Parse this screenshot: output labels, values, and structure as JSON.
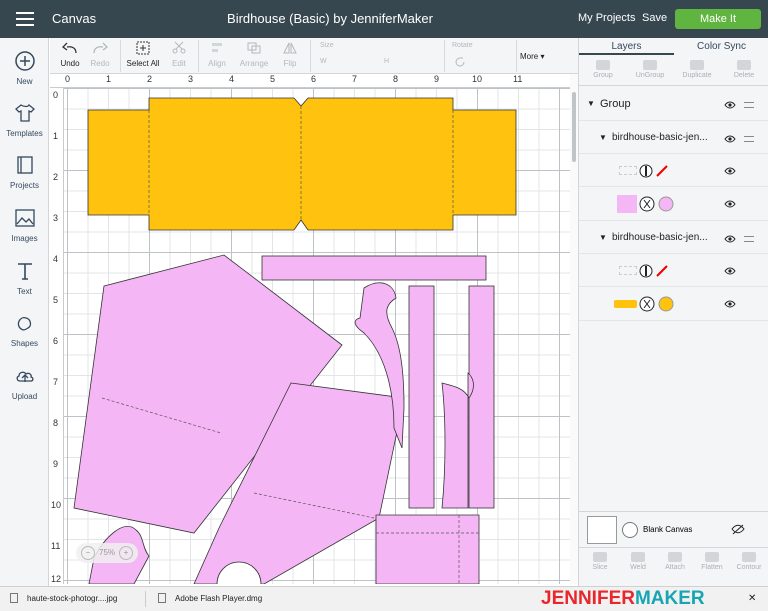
{
  "header": {
    "app_title": "Canvas",
    "project_title": "Birdhouse (Basic) by JenniferMaker",
    "my_projects": "My Projects",
    "save": "Save",
    "make_it": "Make It",
    "make_it_color": "#5fb53f",
    "bar_color": "#37474f"
  },
  "left_tools": [
    {
      "label": "New",
      "icon": "plus-circle-icon"
    },
    {
      "label": "Templates",
      "icon": "tshirt-icon"
    },
    {
      "label": "Projects",
      "icon": "book-icon"
    },
    {
      "label": "Images",
      "icon": "image-icon"
    },
    {
      "label": "Text",
      "icon": "text-t-icon"
    },
    {
      "label": "Shapes",
      "icon": "shapes-icon"
    },
    {
      "label": "Upload",
      "icon": "cloud-upload-icon"
    }
  ],
  "edit_toolbar": {
    "undo": "Undo",
    "redo": "Redo",
    "select_all": "Select All",
    "edit": "Edit",
    "align": "Align",
    "arrange": "Arrange",
    "flip": "Flip",
    "size": "Size",
    "w": "W",
    "h": "H",
    "rotate": "Rotate",
    "more": "More"
  },
  "ruler": {
    "top": [
      "0",
      "1",
      "2",
      "3",
      "4",
      "5",
      "6",
      "7",
      "8",
      "9",
      "10",
      "11"
    ],
    "left": [
      "0",
      "1",
      "2",
      "3",
      "4",
      "5",
      "6",
      "7",
      "8",
      "9",
      "10",
      "11",
      "12"
    ]
  },
  "canvas": {
    "zoom": "75%",
    "zoom_out": "−",
    "zoom_in": "+",
    "piece_colors": {
      "roof": "#ffc20e",
      "walls": "#f5b6f5"
    }
  },
  "right_panel": {
    "tabs": [
      "Layers",
      "Color Sync"
    ],
    "tools": [
      "Group",
      "UnGroup",
      "Duplicate",
      "Delete"
    ],
    "layers": [
      {
        "label": "Group",
        "level": 0
      },
      {
        "label": "birdhouse-basic-jen...",
        "level": 1
      },
      {
        "label": "",
        "level": 2,
        "swatch": "score"
      },
      {
        "label": "",
        "level": 2,
        "swatch": "pink"
      },
      {
        "label": "birdhouse-basic-jen...",
        "level": 1
      },
      {
        "label": "",
        "level": 2,
        "swatch": "score"
      },
      {
        "label": "",
        "level": 2,
        "swatch": "yellow"
      }
    ],
    "blank_canvas": "Blank Canvas",
    "bottom_tools": [
      "Slice",
      "Weld",
      "Attach",
      "Flatten",
      "Contour"
    ]
  },
  "downloads": {
    "file1": "haute-stock-photogr....jpg",
    "file2": "Adobe Flash Player.dmg",
    "close": "✕"
  },
  "watermark": {
    "part1": "JENNIFER",
    "part2": "MAKER",
    "color1": "#e8262c",
    "color2": "#17a5b3"
  }
}
